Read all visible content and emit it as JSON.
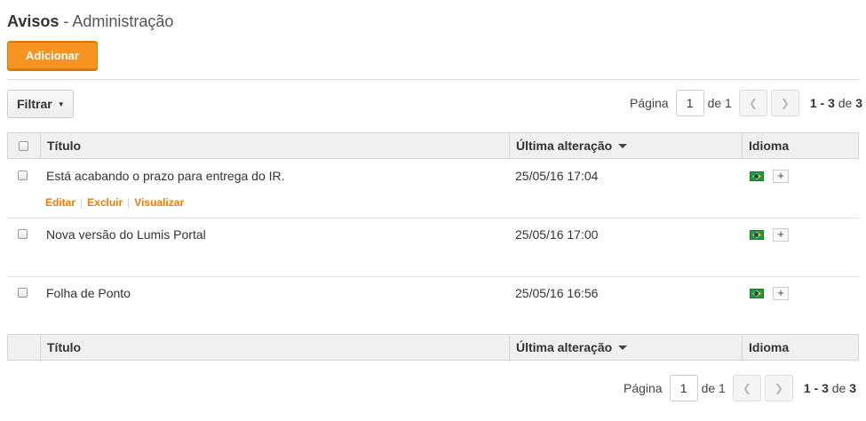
{
  "header": {
    "title_bold": "Avisos",
    "title_rest": " - Administração"
  },
  "toolbar": {
    "add_label": "Adicionar",
    "filter_label": "Filtrar"
  },
  "pager": {
    "page_label": "Página",
    "page_value": "1",
    "of_label": "de 1",
    "range_bold": "1 - 3",
    "range_of": "de",
    "range_total": "3",
    "prev_icon": "chevron-left-icon",
    "next_icon": "chevron-right-icon"
  },
  "table": {
    "col_title": "Título",
    "col_modified": "Última alteração",
    "col_language": "Idioma",
    "rows": [
      {
        "title": "Está acabando o prazo para entrega do IR.",
        "modified": "25/05/16 17:04",
        "actions": {
          "edit": "Editar",
          "delete": "Excluir",
          "view": "Visualizar"
        }
      },
      {
        "title": "Nova versão do Lumis Portal",
        "modified": "25/05/16 17:00"
      },
      {
        "title": "Folha de Ponto",
        "modified": "25/05/16 16:56"
      }
    ],
    "add_language_symbol": "+"
  },
  "colors": {
    "accent": "#f79321",
    "link": "#f07c00",
    "header_bg": "#f0f0f0"
  }
}
